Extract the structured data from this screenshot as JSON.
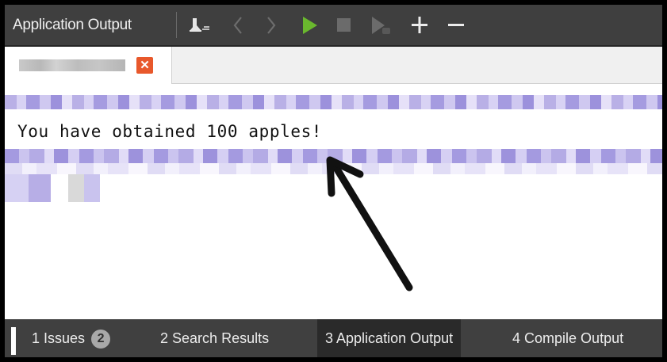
{
  "toolbar": {
    "title": "Application Output",
    "icons": [
      "clear-output-icon",
      "previous-icon",
      "next-icon",
      "run-icon",
      "stop-icon",
      "attach-debugger-icon",
      "zoom-in-icon",
      "zoom-out-icon"
    ],
    "run_color": "#6ab82e"
  },
  "tab": {
    "name": "",
    "close_symbol": "✕",
    "close_color": "#e8582b"
  },
  "output": {
    "line": "You have obtained 100 apples!"
  },
  "bottom": {
    "tabs": [
      {
        "number": "1",
        "label": "Issues",
        "badge": "2"
      },
      {
        "number": "2",
        "label": "Search Results"
      },
      {
        "number": "3",
        "label": "Application Output"
      },
      {
        "number": "4",
        "label": "Compile Output"
      }
    ],
    "active": "Application Output"
  }
}
